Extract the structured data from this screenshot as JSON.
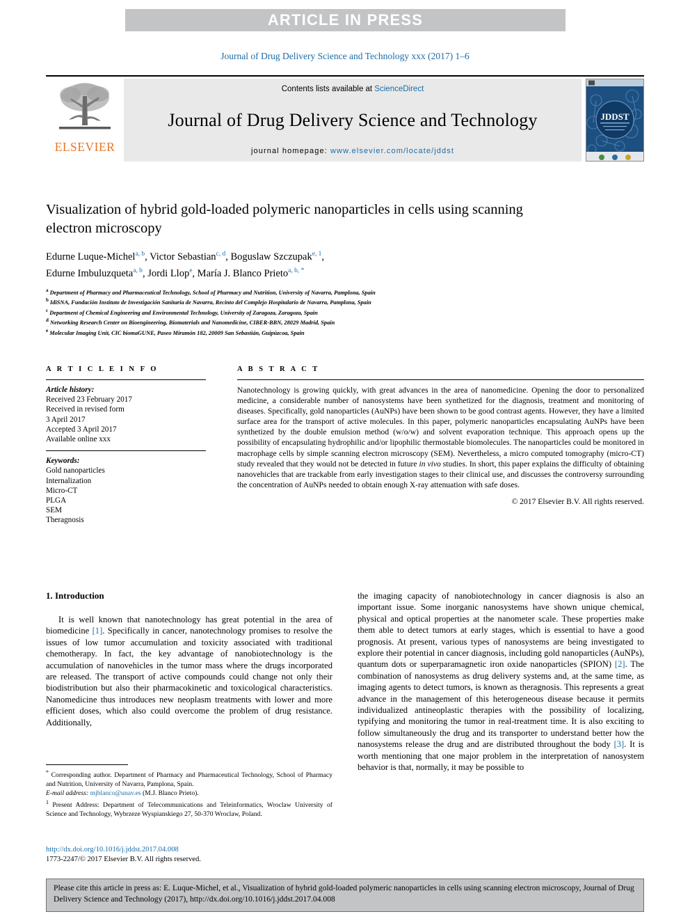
{
  "banner": {
    "label": "ARTICLE IN PRESS"
  },
  "running_head": "Journal of Drug Delivery Science and Technology xxx (2017) 1–6",
  "masthead": {
    "contents_prefix": "Contents lists available at ",
    "contents_link": "ScienceDirect",
    "journal_title": "Journal of Drug Delivery Science and Technology",
    "homepage_prefix": "journal homepage: ",
    "homepage_url": "www.elsevier.com/locate/jddst",
    "publisher": "ELSEVIER",
    "cover_label": "JDDST",
    "colors": {
      "link": "#1b6ca8",
      "elsevier_orange": "#e87722",
      "banner_gray": "#c3c4c6",
      "masthead_gray": "#e9e9e9"
    }
  },
  "article": {
    "title": "Visualization of hybrid gold-loaded polymeric nanoparticles in cells using scanning electron microscopy",
    "authors_line1": "Edurne Luque-Michel",
    "authors": [
      {
        "name": "Edurne Luque-Michel",
        "marks": "a, b"
      },
      {
        "name": "Victor Sebastian",
        "marks": "c, d"
      },
      {
        "name": "Boguslaw Szczupak",
        "marks": "e, 1"
      },
      {
        "name": "Edurne Imbuluzqueta",
        "marks": "a, b"
      },
      {
        "name": "Jordi Llop",
        "marks": "e"
      },
      {
        "name": "María J. Blanco Prieto",
        "marks": "a, b, *"
      }
    ],
    "affiliations": [
      {
        "mark": "a",
        "text": "Department of Pharmacy and Pharmaceutical Technology, School of Pharmacy and Nutrition, University of Navarra, Pamplona, Spain"
      },
      {
        "mark": "b",
        "text": "IdiSNA, Fundación Instituto de Investigación Sanitaria de Navarra, Recinto del Complejo Hospitalario de Navarra, Pamplona, Spain"
      },
      {
        "mark": "c",
        "text": "Department of Chemical Engineering and Environmental Technology, University of Zaragoza, Zaragoza, Spain"
      },
      {
        "mark": "d",
        "text": "Networking Research Center on Bioengineering, Biomaterials and Nanomedicine, CIBER-BBN, 28029 Madrid, Spain"
      },
      {
        "mark": "e",
        "text": "Molecular Imaging Unit, CIC biomaGUNE, Paseo Miramón 182, 20009 San Sebastián, Guipúzcoa, Spain"
      }
    ]
  },
  "article_info": {
    "heading": "A R T I C L E  I N F O",
    "history_label": "Article history:",
    "history": [
      "Received 23 February 2017",
      "Received in revised form",
      "3 April 2017",
      "Accepted 3 April 2017",
      "Available online xxx"
    ],
    "keywords_label": "Keywords:",
    "keywords": [
      "Gold nanoparticles",
      "Internalization",
      "Micro-CT",
      "PLGA",
      "SEM",
      "Theragnosis"
    ]
  },
  "abstract": {
    "heading": "A B S T R A C T",
    "text": "Nanotechnology is growing quickly, with great advances in the area of nanomedicine. Opening the door to personalized medicine, a considerable number of nanosystems have been synthetized for the diagnosis, treatment and monitoring of diseases. Specifically, gold nanoparticles (AuNPs) have been shown to be good contrast agents. However, they have a limited surface area for the transport of active molecules. In this paper, polymeric nanoparticles encapsulating AuNPs have been synthetized by the double emulsion method (w/o/w) and solvent evaporation technique. This approach opens up the possibility of encapsulating hydrophilic and/or lipophilic thermostable biomolecules. The nanoparticles could be monitored in macrophage cells by simple scanning electron microscopy (SEM). Nevertheless, a micro computed tomography (micro-CT) study revealed that they would not be detected in future in vivo studies. In short, this paper explains the difficulty of obtaining nanovehicles that are trackable from early investigation stages to their clinical use, and discusses the controversy surrounding the concentration of AuNPs needed to obtain enough X-ray attenuation with safe doses.",
    "copyright": "© 2017 Elsevier B.V. All rights reserved."
  },
  "body": {
    "section_heading": "1. Introduction",
    "left_paragraph": "It is well known that nanotechnology has great potential in the area of biomedicine [1]. Specifically in cancer, nanotechnology promises to resolve the issues of low tumor accumulation and toxicity associated with traditional chemotherapy. In fact, the key advantage of nanobiotechnology is the accumulation of nanovehicles in the tumor mass where the drugs incorporated are released. The transport of active compounds could change not only their biodistribution but also their pharmacokinetic and toxicological characteristics. Nanomedicine thus introduces new neoplasm treatments with lower and more efficient doses, which also could overcome the problem of drug resistance. Additionally,",
    "right_paragraph": "the imaging capacity of nanobiotechnology in cancer diagnosis is also an important issue. Some inorganic nanosystems have shown unique chemical, physical and optical properties at the nanometer scale. These properties make them able to detect tumors at early stages, which is essential to have a good prognosis. At present, various types of nanosystems are being investigated to explore their potential in cancer diagnosis, including gold nanoparticles (AuNPs), quantum dots or superparamagnetic iron oxide nanoparticles (SPION) [2]. The combination of nanosystems as drug delivery systems and, at the same time, as imaging agents to detect tumors, is known as theragnosis. This represents a great advance in the management of this heterogeneous disease because it permits individualized antineoplastic therapies with the possibility of localizing, typifying and monitoring the tumor in real-treatment time. It is also exciting to follow simultaneously the drug and its transporter to understand better how the nanosystems release the drug and are distributed throughout the body [3]. It is worth mentioning that one major problem in the interpretation of nanosystem behavior is that, normally, it may be possible to"
  },
  "footnotes": {
    "corresponding": "* Corresponding author. Department of Pharmacy and Pharmaceutical Technology, School of Pharmacy and Nutrition, University of Navarra, Pamplona, Spain.",
    "email_label": "E-mail address:",
    "email": "mjblanco@unav.es",
    "email_owner": "(M.J. Blanco Prieto).",
    "present_address": "1 Present Address: Department of Telecommunications and Teleinformatics, Wroclaw University of Science and Technology, Wybrzeze Wyspianskiego 27, 50-370 Wroclaw, Poland.",
    "doi": "http://dx.doi.org/10.1016/j.jddst.2017.04.008",
    "issn_line": "1773-2247/© 2017 Elsevier B.V. All rights reserved."
  },
  "cite_box": {
    "text": "Please cite this article in press as: E. Luque-Michel, et al., Visualization of hybrid gold-loaded polymeric nanoparticles in cells using scanning electron microscopy, Journal of Drug Delivery Science and Technology (2017), http://dx.doi.org/10.1016/j.jddst.2017.04.008"
  }
}
